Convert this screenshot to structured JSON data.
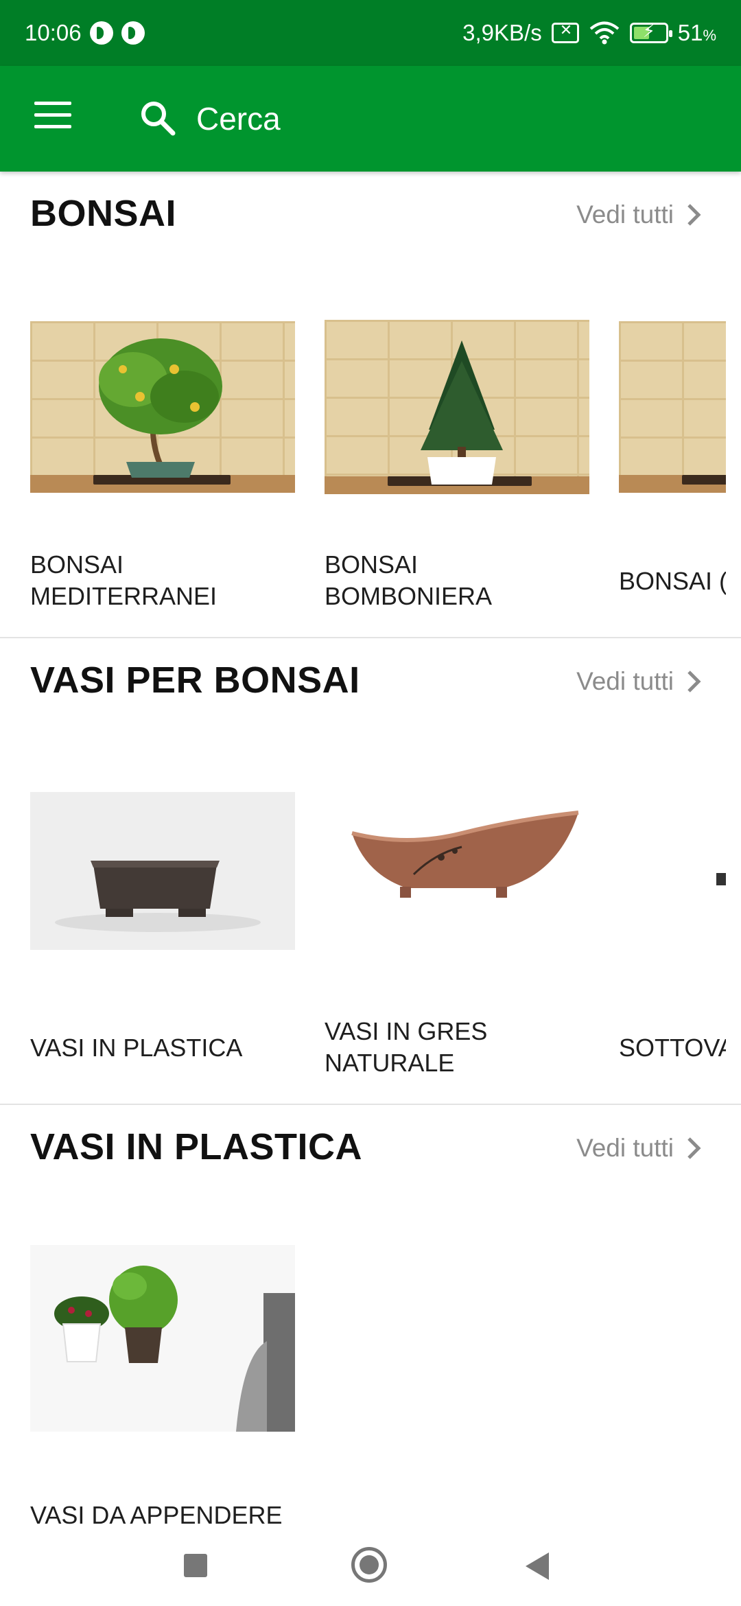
{
  "status_bar": {
    "time": "10:06",
    "network_speed": "3,9KB/s",
    "battery_percent": "51",
    "battery_sign": "%",
    "battery_level": 0.51
  },
  "app_bar": {
    "search_label": "Cerca"
  },
  "sections": [
    {
      "title": "BONSAI",
      "see_all": "Vedi tutti",
      "cards": [
        {
          "label": "BONSAI\nMEDITERRANEI"
        },
        {
          "label": "BONSAI\nBOMBONIERA"
        },
        {
          "label": "BONSAI ("
        }
      ]
    },
    {
      "title": "VASI PER BONSAI",
      "see_all": "Vedi tutti",
      "cards": [
        {
          "label": "VASI IN PLASTICA"
        },
        {
          "label": "VASI IN GRES\nNATURALE"
        },
        {
          "label": "SOTTOVA"
        }
      ]
    },
    {
      "title": "VASI IN PLASTICA",
      "see_all": "Vedi tutti",
      "cards": [
        {
          "label": "VASI DA APPENDERE"
        }
      ]
    }
  ],
  "colors": {
    "status_bar": "#007e26",
    "app_bar": "#00952e",
    "see_all_text": "#8b8b8b"
  }
}
